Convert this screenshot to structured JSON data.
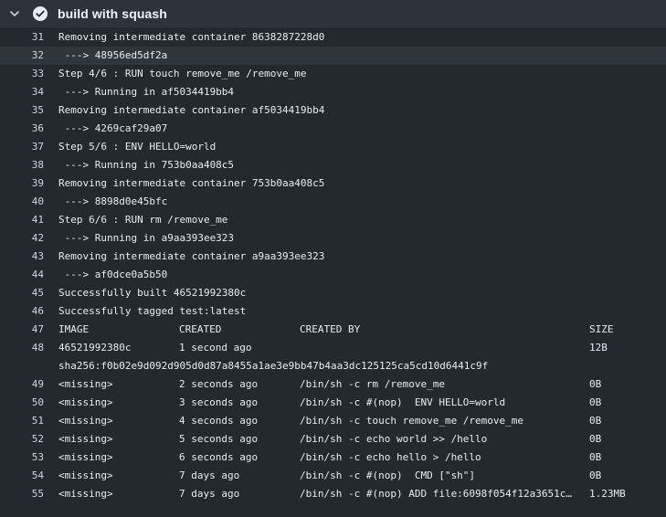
{
  "step": {
    "title": "build with squash",
    "status_color": "#e6edf3",
    "icons": {
      "toggle": "chevron-down-icon",
      "status": "check-circle-icon"
    }
  },
  "log_lines": [
    {
      "n": "31",
      "text": "Removing intermediate container 8638287228d0"
    },
    {
      "n": "32",
      "text": " ---> 48956ed5df2a",
      "highlight": true
    },
    {
      "n": "33",
      "text": "Step 4/6 : RUN touch remove_me /remove_me"
    },
    {
      "n": "34",
      "text": " ---> Running in af5034419bb4"
    },
    {
      "n": "35",
      "text": "Removing intermediate container af5034419bb4"
    },
    {
      "n": "36",
      "text": " ---> 4269caf29a07"
    },
    {
      "n": "37",
      "text": "Step 5/6 : ENV HELLO=world"
    },
    {
      "n": "38",
      "text": " ---> Running in 753b0aa408c5"
    },
    {
      "n": "39",
      "text": "Removing intermediate container 753b0aa408c5"
    },
    {
      "n": "40",
      "text": " ---> 8898d0e45bfc"
    },
    {
      "n": "41",
      "text": "Step 6/6 : RUN rm /remove_me"
    },
    {
      "n": "42",
      "text": " ---> Running in a9aa393ee323"
    },
    {
      "n": "43",
      "text": "Removing intermediate container a9aa393ee323"
    },
    {
      "n": "44",
      "text": " ---> af0dce0a5b50"
    },
    {
      "n": "45",
      "text": "Successfully built 46521992380c"
    },
    {
      "n": "46",
      "text": "Successfully tagged test:latest"
    },
    {
      "n": "47",
      "cols": [
        "IMAGE",
        "CREATED",
        "CREATED BY",
        "SIZE"
      ]
    },
    {
      "n": "48",
      "cols": [
        "46521992380c",
        "1 second ago",
        "",
        "12B"
      ]
    },
    {
      "n": "",
      "text": "sha256:f0b02e9d092d905d0d87a8455a1ae3e9bb47b4aa3dc125125ca5cd10d6441c9f"
    },
    {
      "n": "49",
      "cols": [
        "<missing>",
        "2 seconds ago",
        "/bin/sh -c rm /remove_me",
        "0B"
      ]
    },
    {
      "n": "50",
      "cols": [
        "<missing>",
        "3 seconds ago",
        "/bin/sh -c #(nop)  ENV HELLO=world",
        "0B"
      ]
    },
    {
      "n": "51",
      "cols": [
        "<missing>",
        "4 seconds ago",
        "/bin/sh -c touch remove_me /remove_me",
        "0B"
      ]
    },
    {
      "n": "52",
      "cols": [
        "<missing>",
        "5 seconds ago",
        "/bin/sh -c echo world >> /hello",
        "0B"
      ]
    },
    {
      "n": "53",
      "cols": [
        "<missing>",
        "6 seconds ago",
        "/bin/sh -c echo hello > /hello",
        "0B"
      ]
    },
    {
      "n": "54",
      "cols": [
        "<missing>",
        "7 days ago",
        "/bin/sh -c #(nop)  CMD [\"sh\"]",
        "0B"
      ]
    },
    {
      "n": "55",
      "cols": [
        "<missing>",
        "7 days ago",
        "/bin/sh -c #(nop) ADD file:6098f054f12a3651c…",
        "1.23MB"
      ]
    }
  ]
}
